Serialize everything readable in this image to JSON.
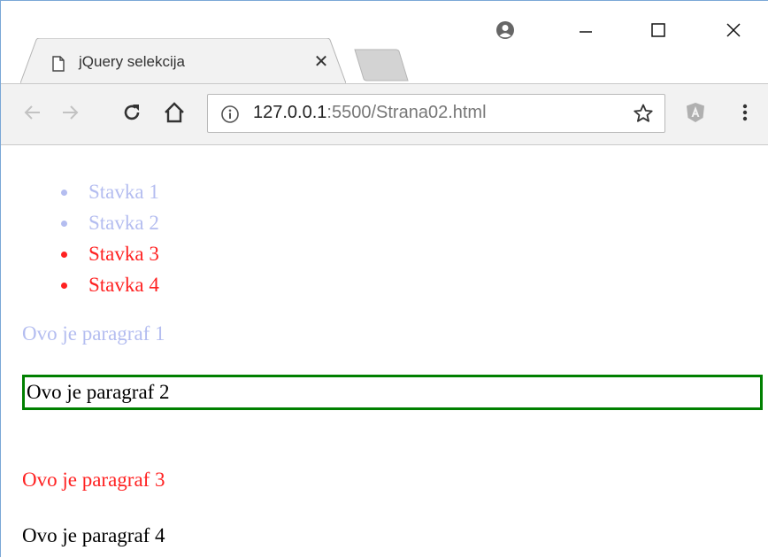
{
  "browser": {
    "tab_title": "jQuery selekcija",
    "url_host": "127.0.0.1",
    "url_rest": ":5500/Strana02.html",
    "icons": {
      "tab_icon": "document-icon",
      "tab_close": "close-icon",
      "profile": "account-icon",
      "minimize": "minimize-icon",
      "maximize": "maximize-icon",
      "close": "close-icon",
      "back": "back-arrow-icon",
      "forward": "forward-arrow-icon",
      "reload": "reload-icon",
      "home": "home-icon",
      "info": "info-icon",
      "bookmark": "star-icon",
      "extension": "angular-extension-icon",
      "menu": "kebab-menu-icon"
    }
  },
  "colors": {
    "faded": "#b4bdf0",
    "red": "#ff2222",
    "black": "#000000",
    "border_green": "#008000"
  },
  "list_items": [
    {
      "label": "Stavka 1",
      "color": "#b4bdf0"
    },
    {
      "label": "Stavka 2",
      "color": "#b4bdf0"
    },
    {
      "label": "Stavka 3",
      "color": "#ff2222"
    },
    {
      "label": "Stavka 4",
      "color": "#ff2222"
    }
  ],
  "paragraphs": [
    {
      "text": "Ovo je paragraf 1",
      "color": "#b4bdf0",
      "boxed": false
    },
    {
      "text": "Ovo je paragraf 2",
      "color": "#000000",
      "boxed": true
    },
    {
      "text": "Ovo je paragraf 3",
      "color": "#ff2222",
      "boxed": false
    },
    {
      "text": "Ovo je paragraf 4",
      "color": "#000000",
      "boxed": false
    }
  ]
}
